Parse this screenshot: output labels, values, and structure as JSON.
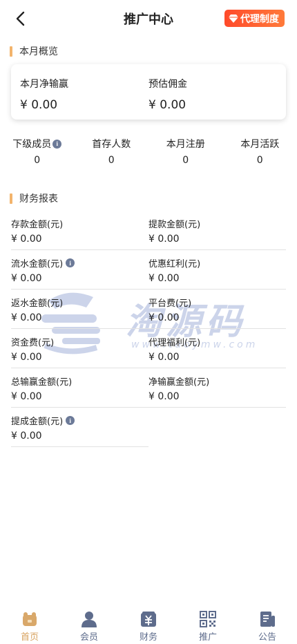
{
  "header": {
    "title": "推广中心",
    "agent_button": "代理制度"
  },
  "overview": {
    "section_title": "本月概览",
    "net_win_label": "本月净输赢",
    "net_win_value": "¥ 0.00",
    "commission_label": "预估佣金",
    "commission_value": "¥ 0.00"
  },
  "stats": [
    {
      "label": "下级成员",
      "value": "0",
      "info": true
    },
    {
      "label": "首存人数",
      "value": "0"
    },
    {
      "label": "本月注册",
      "value": "0"
    },
    {
      "label": "本月活跃",
      "value": "0"
    }
  ],
  "finance": {
    "section_title": "财务报表",
    "items": [
      {
        "label": "存款金额(元)",
        "value": "¥ 0.00"
      },
      {
        "label": "提款金额(元)",
        "value": "¥ 0.00"
      },
      {
        "label": "流水金额(元)",
        "value": "¥ 0.00",
        "info": true
      },
      {
        "label": "优惠红利(元)",
        "value": "¥ 0.00"
      },
      {
        "label": "返水金额(元)",
        "value": "¥ 0.00"
      },
      {
        "label": "平台费(元)",
        "value": "¥ 0.00"
      },
      {
        "label": "资金费(元)",
        "value": "¥ 0.00"
      },
      {
        "label": "代理福利(元)",
        "value": "¥ 0.00"
      },
      {
        "label": "总输赢金额(元)",
        "value": "¥ 0.00"
      },
      {
        "label": "净输赢金额(元)",
        "value": "¥ 0.00"
      },
      {
        "label": "提成金额(元)",
        "value": "¥ 0.00",
        "info": true
      }
    ]
  },
  "info_glyph": "i",
  "watermark": {
    "text": "淘源码",
    "sub": "www.taoymw.com"
  },
  "tabbar": [
    {
      "label": "首页",
      "icon": "home-icon",
      "active": true
    },
    {
      "label": "会员",
      "icon": "member-icon"
    },
    {
      "label": "财务",
      "icon": "finance-icon"
    },
    {
      "label": "推广",
      "icon": "qrcode-icon"
    },
    {
      "label": "公告",
      "icon": "notice-icon"
    }
  ],
  "colors": {
    "accent_orange": "#f3b46c",
    "agent_button": "#ff5a30",
    "tab_icon": "#5e6c8c",
    "tab_active": "#d7a25e"
  }
}
